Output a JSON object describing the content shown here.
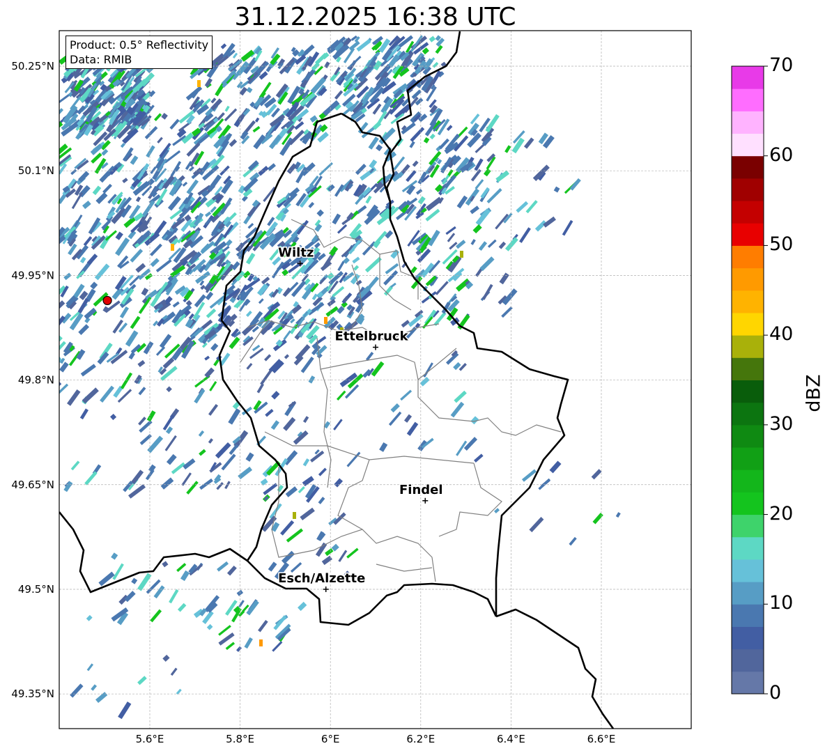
{
  "title": "31.12.2025 16:38 UTC",
  "info": {
    "product": "Product: 0.5° Reflectivity",
    "source": "Data: RMIB"
  },
  "axes": {
    "lon_ticks": [
      5.6,
      5.8,
      6.0,
      6.2,
      6.4,
      6.6
    ],
    "lon_labels": [
      "5.6°E",
      "5.8°E",
      "6°E",
      "6.2°E",
      "6.4°E",
      "6.6°E"
    ],
    "lat_ticks": [
      50.25,
      50.1,
      49.95,
      49.8,
      49.65,
      49.5,
      49.35
    ],
    "lat_labels": [
      "50.25°N",
      "50.1°N",
      "49.95°N",
      "49.8°N",
      "49.65°N",
      "49.5°N",
      "49.35°N"
    ],
    "lon_range": [
      5.4,
      6.8
    ],
    "lat_range": [
      49.3,
      50.3
    ],
    "grid": true
  },
  "cities": [
    {
      "name": "Wiltz",
      "lon": 5.933,
      "lat": 49.967
    },
    {
      "name": "Ettelbruck",
      "lon": 6.1,
      "lat": 49.847
    },
    {
      "name": "Findel",
      "lon": 6.21,
      "lat": 49.627
    },
    {
      "name": "Esch/Alzette",
      "lon": 5.99,
      "lat": 49.5
    }
  ],
  "radar_site": {
    "lon": 5.506,
    "lat": 49.914
  },
  "colorbar": {
    "label": "dBZ",
    "ticks": [
      0,
      10,
      20,
      30,
      40,
      50,
      60,
      70
    ],
    "tick_labels": [
      "0",
      "10",
      "20",
      "30",
      "40",
      "50",
      "60",
      "70"
    ],
    "step": 2.5,
    "colors": [
      "#6578a8",
      "#51669c",
      "#425ea3",
      "#4a78b0",
      "#579dc5",
      "#66c1d9",
      "#5dd8c4",
      "#3ed36b",
      "#14c41e",
      "#13b61b",
      "#11a015",
      "#0f8a12",
      "#0c7510",
      "#095d0b",
      "#45760c",
      "#a9b10a",
      "#ffd600",
      "#ffb300",
      "#ff9a00",
      "#ff7d00",
      "#e80000",
      "#c40000",
      "#a00000",
      "#7a0000",
      "#ffe0ff",
      "#ffb3ff",
      "#ff6dff",
      "#e83ae8"
    ]
  }
}
